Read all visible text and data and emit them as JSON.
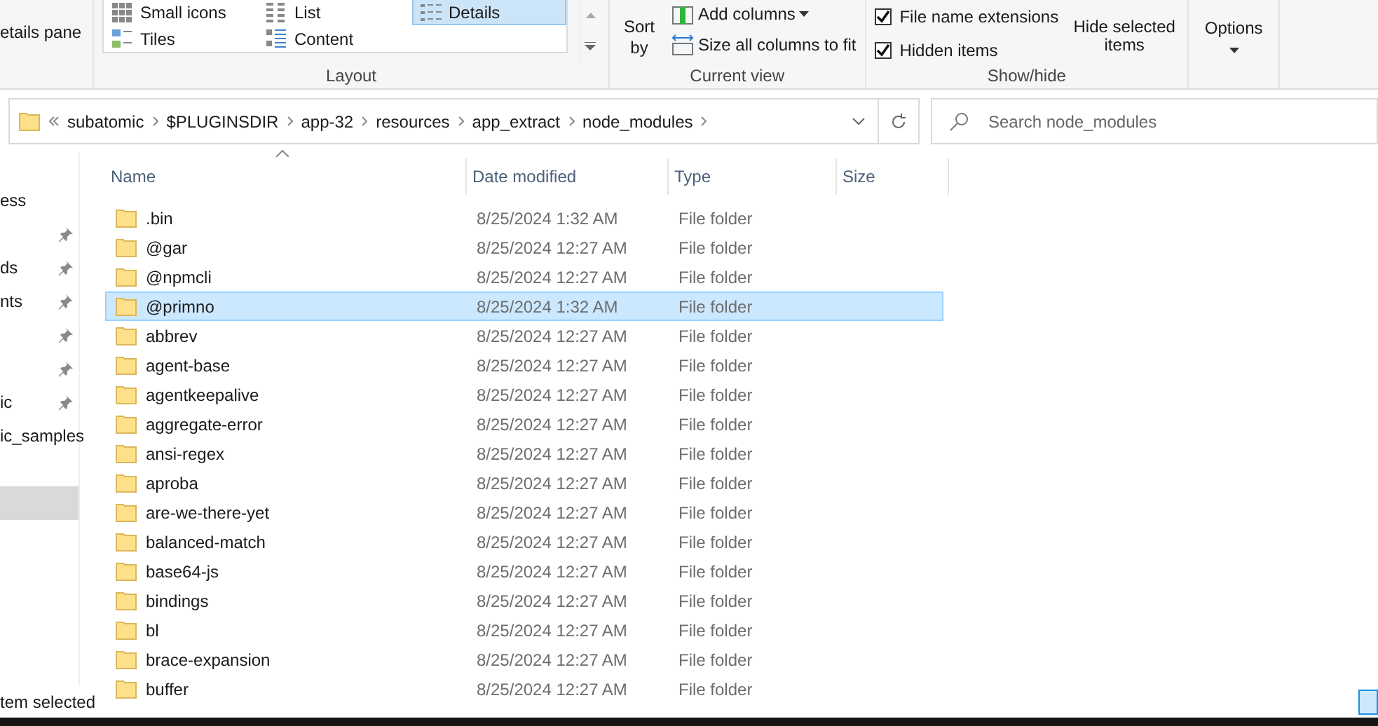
{
  "ribbon": {
    "pane_label": "etails pane",
    "layout": {
      "label": "Layout",
      "options": [
        {
          "label": "Small icons",
          "kind": "grid",
          "selected": false
        },
        {
          "label": "List",
          "kind": "list",
          "selected": false
        },
        {
          "label": "Details",
          "kind": "details",
          "selected": true
        },
        {
          "label": "Tiles",
          "kind": "tiles",
          "selected": false
        },
        {
          "label": "Content",
          "kind": "content",
          "selected": false
        }
      ]
    },
    "current_view": {
      "label": "Current view",
      "sort": "Sort by",
      "add_columns": "Add columns",
      "size_columns": "Size all columns to fit"
    },
    "show_hide": {
      "label": "Show/hide",
      "checkboxes": [
        {
          "label": "File name extensions",
          "checked": true
        },
        {
          "label": "Hidden items",
          "checked": true
        }
      ],
      "hide_selected": "Hide selected items"
    },
    "options": "Options"
  },
  "address": {
    "crumbs": [
      "subatomic",
      "$PLUGINSDIR",
      "app-32",
      "resources",
      "app_extract",
      "node_modules"
    ]
  },
  "search": {
    "placeholder": "Search node_modules"
  },
  "nav": [
    {
      "label": "ess",
      "pinned": false,
      "selected": false
    },
    {
      "pinned": true,
      "selected": false
    },
    {
      "label": "ds",
      "pinned": true,
      "selected": false
    },
    {
      "label": "nts",
      "pinned": true,
      "selected": false
    },
    {
      "pinned": true,
      "selected": false
    },
    {
      "pinned": true,
      "selected": false
    },
    {
      "label": "ic",
      "pinned": true,
      "selected": false
    },
    {
      "label": "ic_samples",
      "pinned": false,
      "selected": false
    },
    {
      "pinned": false,
      "selected": true
    }
  ],
  "columns": [
    "Name",
    "Date modified",
    "Type",
    "Size"
  ],
  "rows": [
    {
      "name": ".bin",
      "date": "8/25/2024 1:32 AM",
      "type": "File folder",
      "selected": false
    },
    {
      "name": "@gar",
      "date": "8/25/2024 12:27 AM",
      "type": "File folder",
      "selected": false
    },
    {
      "name": "@npmcli",
      "date": "8/25/2024 12:27 AM",
      "type": "File folder",
      "selected": false
    },
    {
      "name": "@primno",
      "date": "8/25/2024 1:32 AM",
      "type": "File folder",
      "selected": true
    },
    {
      "name": "abbrev",
      "date": "8/25/2024 12:27 AM",
      "type": "File folder",
      "selected": false
    },
    {
      "name": "agent-base",
      "date": "8/25/2024 12:27 AM",
      "type": "File folder",
      "selected": false
    },
    {
      "name": "agentkeepalive",
      "date": "8/25/2024 12:27 AM",
      "type": "File folder",
      "selected": false
    },
    {
      "name": "aggregate-error",
      "date": "8/25/2024 12:27 AM",
      "type": "File folder",
      "selected": false
    },
    {
      "name": "ansi-regex",
      "date": "8/25/2024 12:27 AM",
      "type": "File folder",
      "selected": false
    },
    {
      "name": "aproba",
      "date": "8/25/2024 12:27 AM",
      "type": "File folder",
      "selected": false
    },
    {
      "name": "are-we-there-yet",
      "date": "8/25/2024 12:27 AM",
      "type": "File folder",
      "selected": false
    },
    {
      "name": "balanced-match",
      "date": "8/25/2024 12:27 AM",
      "type": "File folder",
      "selected": false
    },
    {
      "name": "base64-js",
      "date": "8/25/2024 12:27 AM",
      "type": "File folder",
      "selected": false
    },
    {
      "name": "bindings",
      "date": "8/25/2024 12:27 AM",
      "type": "File folder",
      "selected": false
    },
    {
      "name": "bl",
      "date": "8/25/2024 12:27 AM",
      "type": "File folder",
      "selected": false
    },
    {
      "name": "brace-expansion",
      "date": "8/25/2024 12:27 AM",
      "type": "File folder",
      "selected": false
    },
    {
      "name": "buffer",
      "date": "8/25/2024 12:27 AM",
      "type": "File folder",
      "selected": false
    }
  ],
  "status": "tem selected"
}
